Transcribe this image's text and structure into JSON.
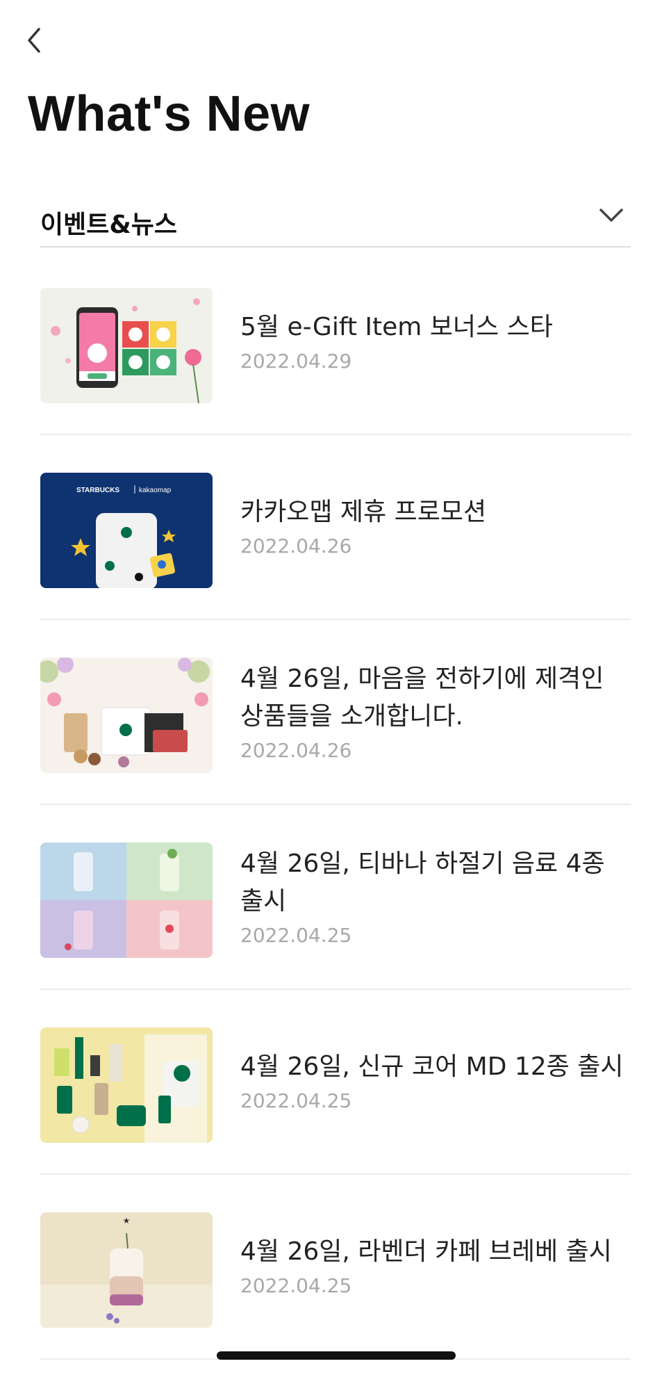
{
  "header": {
    "title": "What's New"
  },
  "filter": {
    "selected": "이벤트&뉴스"
  },
  "items": [
    {
      "title": "5월 e-Gift Item 보너스 스타",
      "date": "2022.04.29",
      "thumb_icon": "e-gift-card-illustration"
    },
    {
      "title": "카카오맵 제휴 프로모션",
      "date": "2022.04.26",
      "thumb_icon": "starbucks-kakaomap-banner",
      "thumb_text": {
        "brand": "STARBUCKS",
        "partner": "kakaomap"
      }
    },
    {
      "title": "4월 26일, 마음을 전하기에 제격인 상품들을 소개합니다.",
      "date": "2022.04.26",
      "thumb_icon": "gift-set-photo"
    },
    {
      "title": "4월 26일, 티바나 하절기 음료 4종 출시",
      "date": "2022.04.25",
      "thumb_icon": "teavana-drinks-photo"
    },
    {
      "title": "4월 26일, 신규 코어 MD 12종 출시",
      "date": "2022.04.25",
      "thumb_icon": "core-md-photo"
    },
    {
      "title": "4월 26일, 라벤더 카페 브레베 출시",
      "date": "2022.04.25",
      "thumb_icon": "lavender-cafe-breve-photo"
    }
  ],
  "colors": {
    "starbucks_green": "#00704A",
    "date_gray": "#A8A8A8",
    "divider": "#EDEDED",
    "kakaomap_navy": "#0F3370"
  }
}
